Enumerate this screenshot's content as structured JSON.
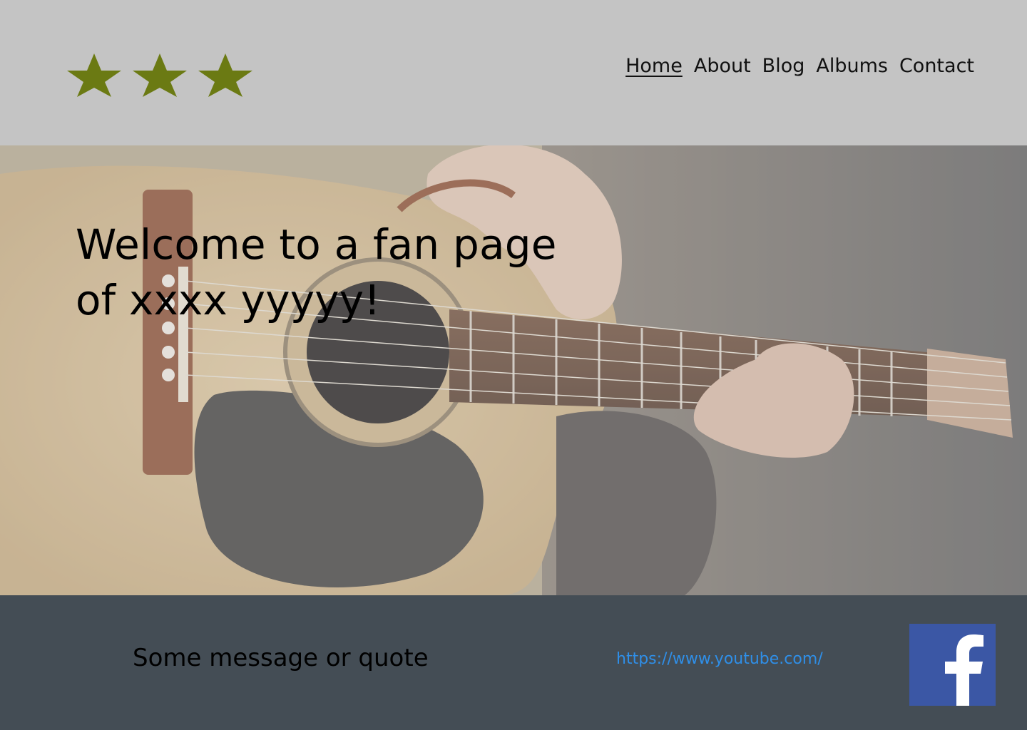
{
  "logo": {
    "stars": 3,
    "star_color": "#6b7a13"
  },
  "nav": {
    "items": [
      {
        "label": "Home",
        "active": true
      },
      {
        "label": "About",
        "active": false
      },
      {
        "label": "Blog",
        "active": false
      },
      {
        "label": "Albums",
        "active": false
      },
      {
        "label": "Contact",
        "active": false
      }
    ]
  },
  "hero": {
    "title_line1": "Welcome to a fan page",
    "title_line2": "of xxxx yyyyy!",
    "image": "guitar-player-photo"
  },
  "footer": {
    "quote": "Some message or quote",
    "link": "https://www.youtube.com/",
    "facebook_icon": "facebook-icon",
    "facebook_color": "#3b57a5"
  },
  "colors": {
    "header_bg": "#c4c4c4",
    "footer_bg": "#444d55",
    "link": "#2f8fe8"
  }
}
